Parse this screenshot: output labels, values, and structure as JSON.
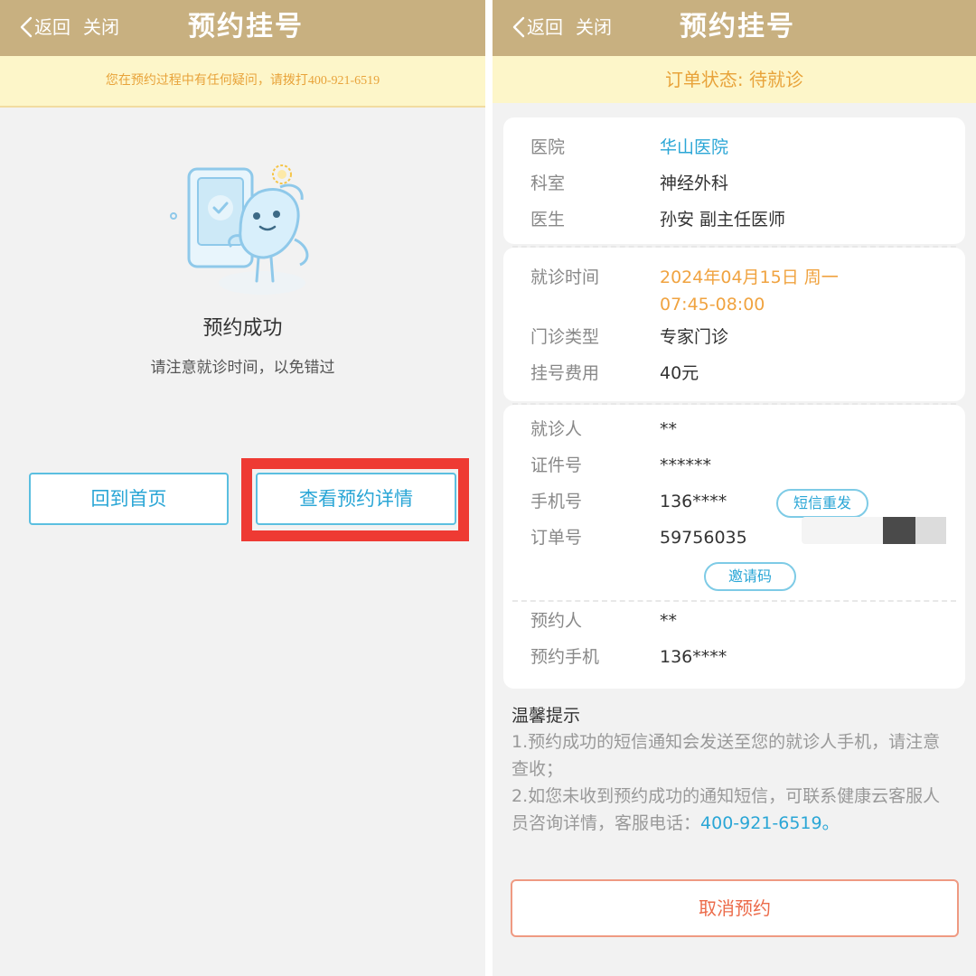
{
  "left": {
    "nav": {
      "back_label": "返回",
      "close_label": "关闭",
      "title": "预约挂号"
    },
    "notice": "您在预约过程中有任何疑问，请拨打400-921-6519",
    "success_title": "预约成功",
    "success_subtitle": "请注意就诊时间，以免错过",
    "buttons": {
      "home": "回到首页",
      "details": "查看预约详情"
    }
  },
  "right": {
    "nav": {
      "back_label": "返回",
      "close_label": "关闭",
      "title": "预约挂号"
    },
    "order_status": "订单状态: 待就诊",
    "hospital": [
      {
        "label": "医院",
        "value": "华山医院"
      },
      {
        "label": "科室",
        "value": "神经外科"
      },
      {
        "label": "医生",
        "value": "孙安 副主任医师"
      }
    ],
    "visit": {
      "time_label": "就诊时间",
      "date": "2024年04月15日 周一",
      "time": "07:45-08:00",
      "type_label": "门诊类型",
      "type_value": "专家门诊",
      "fee_label": "挂号费用",
      "fee_value": "40元"
    },
    "patient": [
      {
        "label": "就诊人",
        "value": "**"
      },
      {
        "label": "证件号",
        "value": "******"
      },
      {
        "label": "手机号",
        "value": "136****"
      },
      {
        "label": "订单号",
        "value": "59756035"
      }
    ],
    "resend_sms_label": "短信重发",
    "invite_code_label": "邀请码",
    "booker": [
      {
        "label": "预约人",
        "value": "**"
      },
      {
        "label": "预约手机",
        "value": "136****"
      }
    ],
    "tips": {
      "title": "温馨提示",
      "line1": "1.预约成功的短信通知会发送至您的就诊人手机，请注意查收；",
      "line2": "2.如您未收到预约成功的通知短信，可联系健康云客服人员咨询详情，客服电话：",
      "phone": "400-921-6519。"
    },
    "cancel_label": "取消预约"
  },
  "colors": {
    "nav_bar": "#c8b080",
    "notice_bg": "#fdf6c9",
    "notice_text": "#e8a33a",
    "link_blue": "#2aa6d6",
    "highlight_red": "#ee3a33",
    "cancel_orange": "#ec6b4a"
  },
  "icons": {
    "back": "chevron-left-icon",
    "illustration": "booking-success-bird-illustration"
  }
}
